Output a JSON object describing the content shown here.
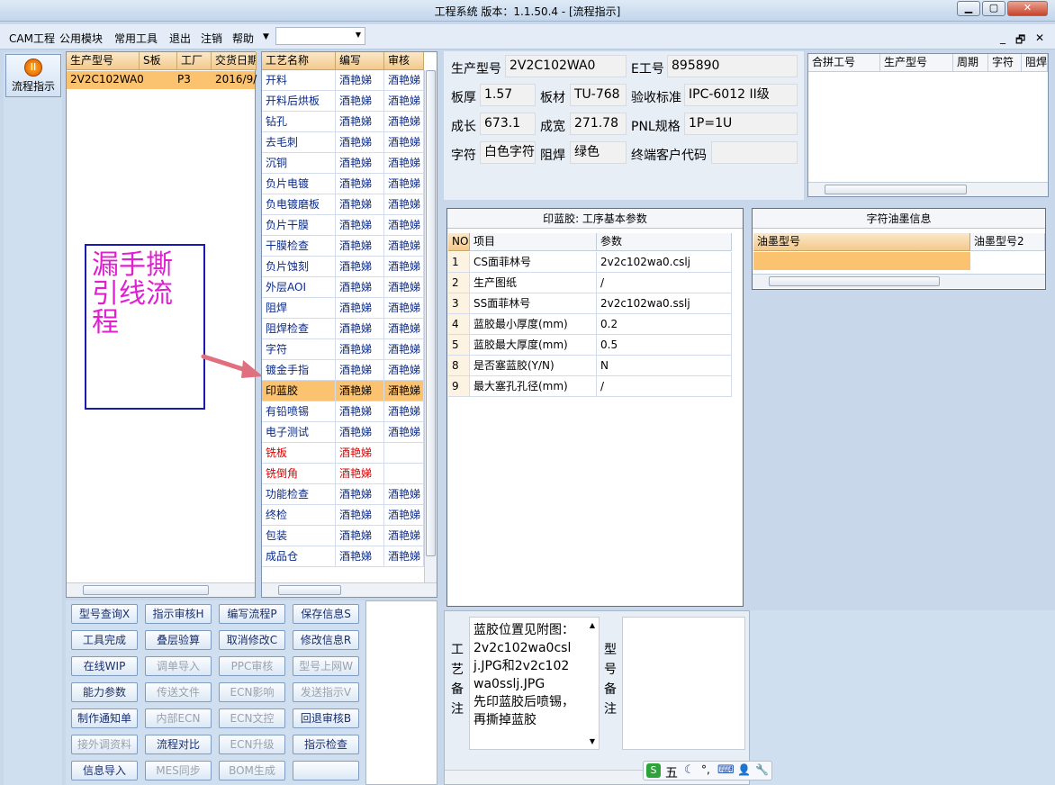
{
  "window": {
    "title": "工程系统  版本：1.1.50.4 - [流程指示]",
    "min_icon": "minimize-icon",
    "max_icon": "maximize-icon",
    "close_icon": "close-icon"
  },
  "menubar": {
    "items": [
      "CAM工程",
      "公用模块",
      "常用工具",
      "退出",
      "注销",
      "帮助"
    ],
    "dropdown_value": "",
    "mdi_controls": [
      "_",
      "🗗",
      "✕"
    ]
  },
  "leftbar": {
    "button_label": "流程指示",
    "button_icon": "flow-indicator-icon"
  },
  "orders": {
    "columns": [
      "生产型号",
      "S板",
      "工厂",
      "交货日期"
    ],
    "rows": [
      {
        "model": "2V2C102WA0",
        "s": "",
        "factory": "P3",
        "date": "2016/9/"
      }
    ]
  },
  "annotation": {
    "text": "漏手撕\n引线流\n程",
    "color": "#e020d0"
  },
  "process": {
    "columns": [
      "工艺名称",
      "编写",
      "审核"
    ],
    "rows": [
      {
        "name": "开料",
        "writer": "酒艳娣",
        "reviewer": "酒艳娣",
        "red": false
      },
      {
        "name": "开料后烘板",
        "writer": "酒艳娣",
        "reviewer": "酒艳娣",
        "red": false
      },
      {
        "name": "钻孔",
        "writer": "酒艳娣",
        "reviewer": "酒艳娣",
        "red": false
      },
      {
        "name": "去毛刺",
        "writer": "酒艳娣",
        "reviewer": "酒艳娣",
        "red": false
      },
      {
        "name": "沉铜",
        "writer": "酒艳娣",
        "reviewer": "酒艳娣",
        "red": false
      },
      {
        "name": "负片电镀",
        "writer": "酒艳娣",
        "reviewer": "酒艳娣",
        "red": false
      },
      {
        "name": "负电镀磨板",
        "writer": "酒艳娣",
        "reviewer": "酒艳娣",
        "red": false
      },
      {
        "name": "负片干膜",
        "writer": "酒艳娣",
        "reviewer": "酒艳娣",
        "red": false
      },
      {
        "name": "干膜检查",
        "writer": "酒艳娣",
        "reviewer": "酒艳娣",
        "red": false
      },
      {
        "name": "负片蚀刻",
        "writer": "酒艳娣",
        "reviewer": "酒艳娣",
        "red": false
      },
      {
        "name": "外层AOI",
        "writer": "酒艳娣",
        "reviewer": "酒艳娣",
        "red": false
      },
      {
        "name": "阻焊",
        "writer": "酒艳娣",
        "reviewer": "酒艳娣",
        "red": false
      },
      {
        "name": "阻焊检查",
        "writer": "酒艳娣",
        "reviewer": "酒艳娣",
        "red": false
      },
      {
        "name": "字符",
        "writer": "酒艳娣",
        "reviewer": "酒艳娣",
        "red": false
      },
      {
        "name": "镀金手指",
        "writer": "酒艳娣",
        "reviewer": "酒艳娣",
        "red": false
      },
      {
        "name": "印蓝胶",
        "writer": "酒艳娣",
        "reviewer": "酒艳娣",
        "red": false,
        "selected": true
      },
      {
        "name": "有铅喷锡",
        "writer": "酒艳娣",
        "reviewer": "酒艳娣",
        "red": false
      },
      {
        "name": "电子测试",
        "writer": "酒艳娣",
        "reviewer": "酒艳娣",
        "red": false
      },
      {
        "name": "铣板",
        "writer": "酒艳娣",
        "reviewer": "",
        "red": true
      },
      {
        "name": "铣倒角",
        "writer": "酒艳娣",
        "reviewer": "",
        "red": true
      },
      {
        "name": "功能检查",
        "writer": "酒艳娣",
        "reviewer": "酒艳娣",
        "red": false
      },
      {
        "name": "终检",
        "writer": "酒艳娣",
        "reviewer": "酒艳娣",
        "red": false
      },
      {
        "name": "包装",
        "writer": "酒艳娣",
        "reviewer": "酒艳娣",
        "red": false
      },
      {
        "name": "成品仓",
        "writer": "酒艳娣",
        "reviewer": "酒艳娣",
        "red": false
      }
    ]
  },
  "buttons": [
    {
      "label": "型号查询X",
      "enabled": true
    },
    {
      "label": "指示审核H",
      "enabled": true
    },
    {
      "label": "编写流程P",
      "enabled": true
    },
    {
      "label": "保存信息S",
      "enabled": true
    },
    {
      "label": "工具完成",
      "enabled": true
    },
    {
      "label": "叠层验算",
      "enabled": true
    },
    {
      "label": "取消修改C",
      "enabled": true
    },
    {
      "label": "修改信息R",
      "enabled": true
    },
    {
      "label": "在线WIP",
      "enabled": true
    },
    {
      "label": "调单导入",
      "enabled": false
    },
    {
      "label": "PPC审核",
      "enabled": false
    },
    {
      "label": "型号上网W",
      "enabled": false
    },
    {
      "label": "能力参数",
      "enabled": true
    },
    {
      "label": "传送文件",
      "enabled": false
    },
    {
      "label": "ECN影响",
      "enabled": false
    },
    {
      "label": "发送指示V",
      "enabled": false
    },
    {
      "label": "制作通知单",
      "enabled": true
    },
    {
      "label": "内部ECN",
      "enabled": false
    },
    {
      "label": "ECN文控",
      "enabled": false
    },
    {
      "label": "回退审核B",
      "enabled": true
    },
    {
      "label": "接外调资料",
      "enabled": false
    },
    {
      "label": "流程对比",
      "enabled": true
    },
    {
      "label": "ECN升级",
      "enabled": false
    },
    {
      "label": "指示检查",
      "enabled": true
    },
    {
      "label": "信息导入",
      "enabled": true
    },
    {
      "label": "MES同步",
      "enabled": false
    },
    {
      "label": "BOM生成",
      "enabled": false
    },
    {
      "label": "",
      "enabled": true
    }
  ],
  "info": {
    "model_label": "生产型号",
    "model": "2V2C102WA0",
    "eng_label": "E工号",
    "eng": "895890",
    "thick_label": "板厚",
    "thick": "1.57",
    "mat_label": "板材",
    "mat": "TU-768",
    "std_label": "验收标准",
    "std": "IPC-6012 II级",
    "len_label": "成长",
    "len": "673.1",
    "wid_label": "成宽",
    "wid": "271.78",
    "pnl_label": "PNL规格",
    "pnl": "1P=1U",
    "char_label": "字符",
    "char": "白色字符",
    "mask_label": "阻焊",
    "mask": "绿色",
    "cust_label": "终端客户代码",
    "cust": ""
  },
  "merge": {
    "columns": [
      "合拼工号",
      "生产型号",
      "周期",
      "字符",
      "阻焊"
    ]
  },
  "params": {
    "title": "印蓝胶: 工序基本参数",
    "columns": [
      "NO",
      "项目",
      "参数"
    ],
    "rows": [
      {
        "no": "1",
        "item": "CS面菲林号",
        "value": "2v2c102wa0.cslj"
      },
      {
        "no": "2",
        "item": "生产图纸",
        "value": "/"
      },
      {
        "no": "3",
        "item": "SS面菲林号",
        "value": "2v2c102wa0.sslj"
      },
      {
        "no": "4",
        "item": "蓝胶最小厚度(mm)",
        "value": "0.2"
      },
      {
        "no": "5",
        "item": "蓝胶最大厚度(mm)",
        "value": "0.5"
      },
      {
        "no": "8",
        "item": "是否塞蓝胶(Y/N)",
        "value": "N"
      },
      {
        "no": "9",
        "item": "最大塞孔孔径(mm)",
        "value": "/"
      }
    ]
  },
  "ink": {
    "title": "字符油墨信息",
    "columns": [
      "油墨型号",
      "油墨型号2"
    ]
  },
  "remarks": {
    "proc_label": "工\n艺\n备\n注",
    "proc_text": "蓝胶位置见附图：2v2c102wa0cslj.JPG和2v2c102wa0sslj.JPG\n先印蓝胶后喷锡，再撕掉蓝胶",
    "model_label": "型\n号\n备\n注",
    "model_text": ""
  },
  "ime": {
    "items": [
      "S",
      "五",
      "☾",
      "°,",
      "⌨",
      "👤",
      "🔧"
    ]
  },
  "colors": {
    "header": "#f3c98c",
    "selected_row": "#fbc270",
    "red_text": "#e00000",
    "annotation_border": "#1a1ab0",
    "arrow": "#e07080"
  }
}
